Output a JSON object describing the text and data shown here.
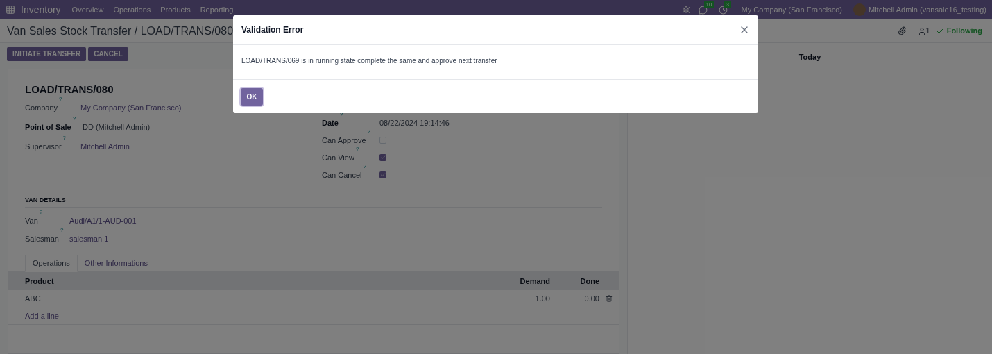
{
  "navbar": {
    "app": "Inventory",
    "menu": [
      "Overview",
      "Operations",
      "Products",
      "Reporting"
    ],
    "badges": [
      {
        "kind": "chat",
        "count": "10"
      },
      {
        "kind": "activity",
        "count": "3"
      }
    ],
    "company": "My Company (San Francisco)",
    "user": "Mitchell Admin (vansale16_testing)"
  },
  "breadcrumb": "Van Sales Stock Transfer / LOAD/TRANS/080",
  "buttons": [
    "INITIATE TRANSFER",
    "CANCEL"
  ],
  "chatter": {
    "followers": "1",
    "following": "Following",
    "day": "Today"
  },
  "form": {
    "title": "LOAD/TRANS/080",
    "left_fields": [
      {
        "label": "Company",
        "help": "?",
        "value": "My Company (San Francisco)",
        "bold": false,
        "link": true
      },
      {
        "label": "Point of Sale",
        "help": "?",
        "value": "DD (Mitchell Admin)",
        "bold": true,
        "link": false
      },
      {
        "label": "Supervisor",
        "help": "?",
        "value": "Mitchell Admin",
        "bold": false,
        "link": true
      }
    ],
    "right_fields": [
      {
        "kind": "text",
        "label": "Date",
        "help": "?",
        "value": "08/22/2024 19:14:46",
        "bold": true
      },
      {
        "kind": "checkbox",
        "label": "Can Approve",
        "help": "?",
        "checked": false,
        "bold": false
      },
      {
        "kind": "checkbox",
        "label": "Can View",
        "help": "?",
        "checked": true,
        "bold": false
      },
      {
        "kind": "checkbox",
        "label": "Can Cancel",
        "help": "?",
        "checked": true,
        "bold": false
      }
    ],
    "section": "VAN DETAILS",
    "van_fields": [
      {
        "label": "Van",
        "help": "?",
        "value": "Audi/A1/1-AUD-001"
      },
      {
        "label": "Salesman",
        "help": "?",
        "value": "salesman 1"
      }
    ],
    "tabs": [
      {
        "label": "Operations",
        "selected": true
      },
      {
        "label": "Other Informations",
        "selected": false
      }
    ],
    "table": {
      "columns": [
        "Product",
        "Demand",
        "Done"
      ],
      "rows": [
        [
          "ABC",
          "1.00",
          "0.00"
        ]
      ],
      "add_line": "Add a line"
    }
  },
  "dialog": {
    "title": "Validation Error",
    "message": "LOAD/TRANS/069 is in running state complete the same and approve next transfer",
    "button": "OK"
  }
}
